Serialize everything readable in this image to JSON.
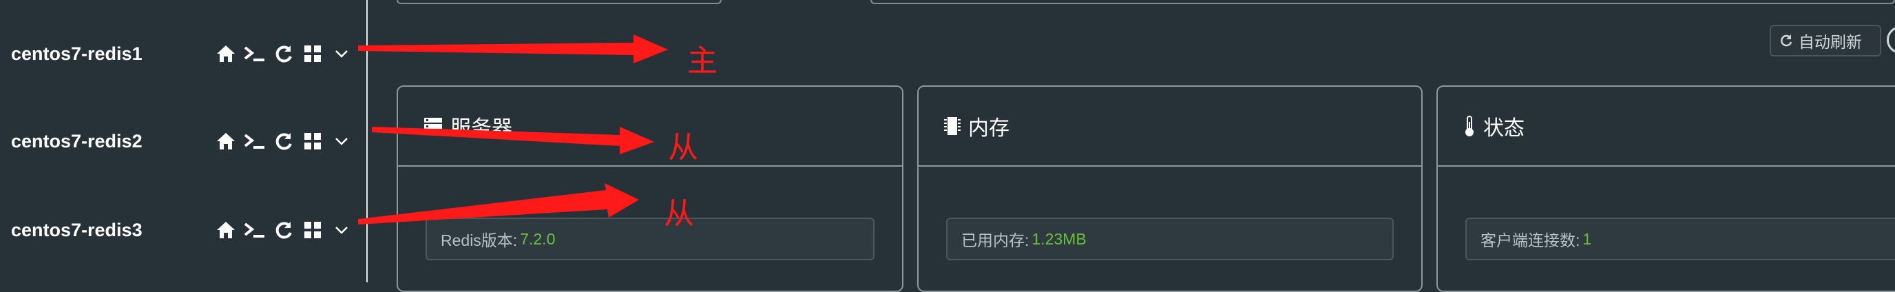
{
  "servers": [
    {
      "name": "centos7-redis1"
    },
    {
      "name": "centos7-redis2"
    },
    {
      "name": "centos7-redis3"
    }
  ],
  "toolbar": {
    "refresh_label": "自动刷新"
  },
  "cards": [
    {
      "title": "服务器",
      "stat_label": "Redis版本:",
      "stat_value": "7.2.0",
      "icon": "server-icon"
    },
    {
      "title": "内存",
      "stat_label": "已用内存:",
      "stat_value": "1.23MB",
      "icon": "memory-chip-icon"
    },
    {
      "title": "状态",
      "stat_label": "客户端连接数:",
      "stat_value": "1",
      "icon": "thermometer-icon"
    }
  ],
  "annotations": [
    "主",
    "从",
    "从"
  ],
  "colors": {
    "background": "#263238",
    "accent_value": "#67c23a",
    "annotation": "#ff1a1a",
    "border": "#8c969c"
  }
}
